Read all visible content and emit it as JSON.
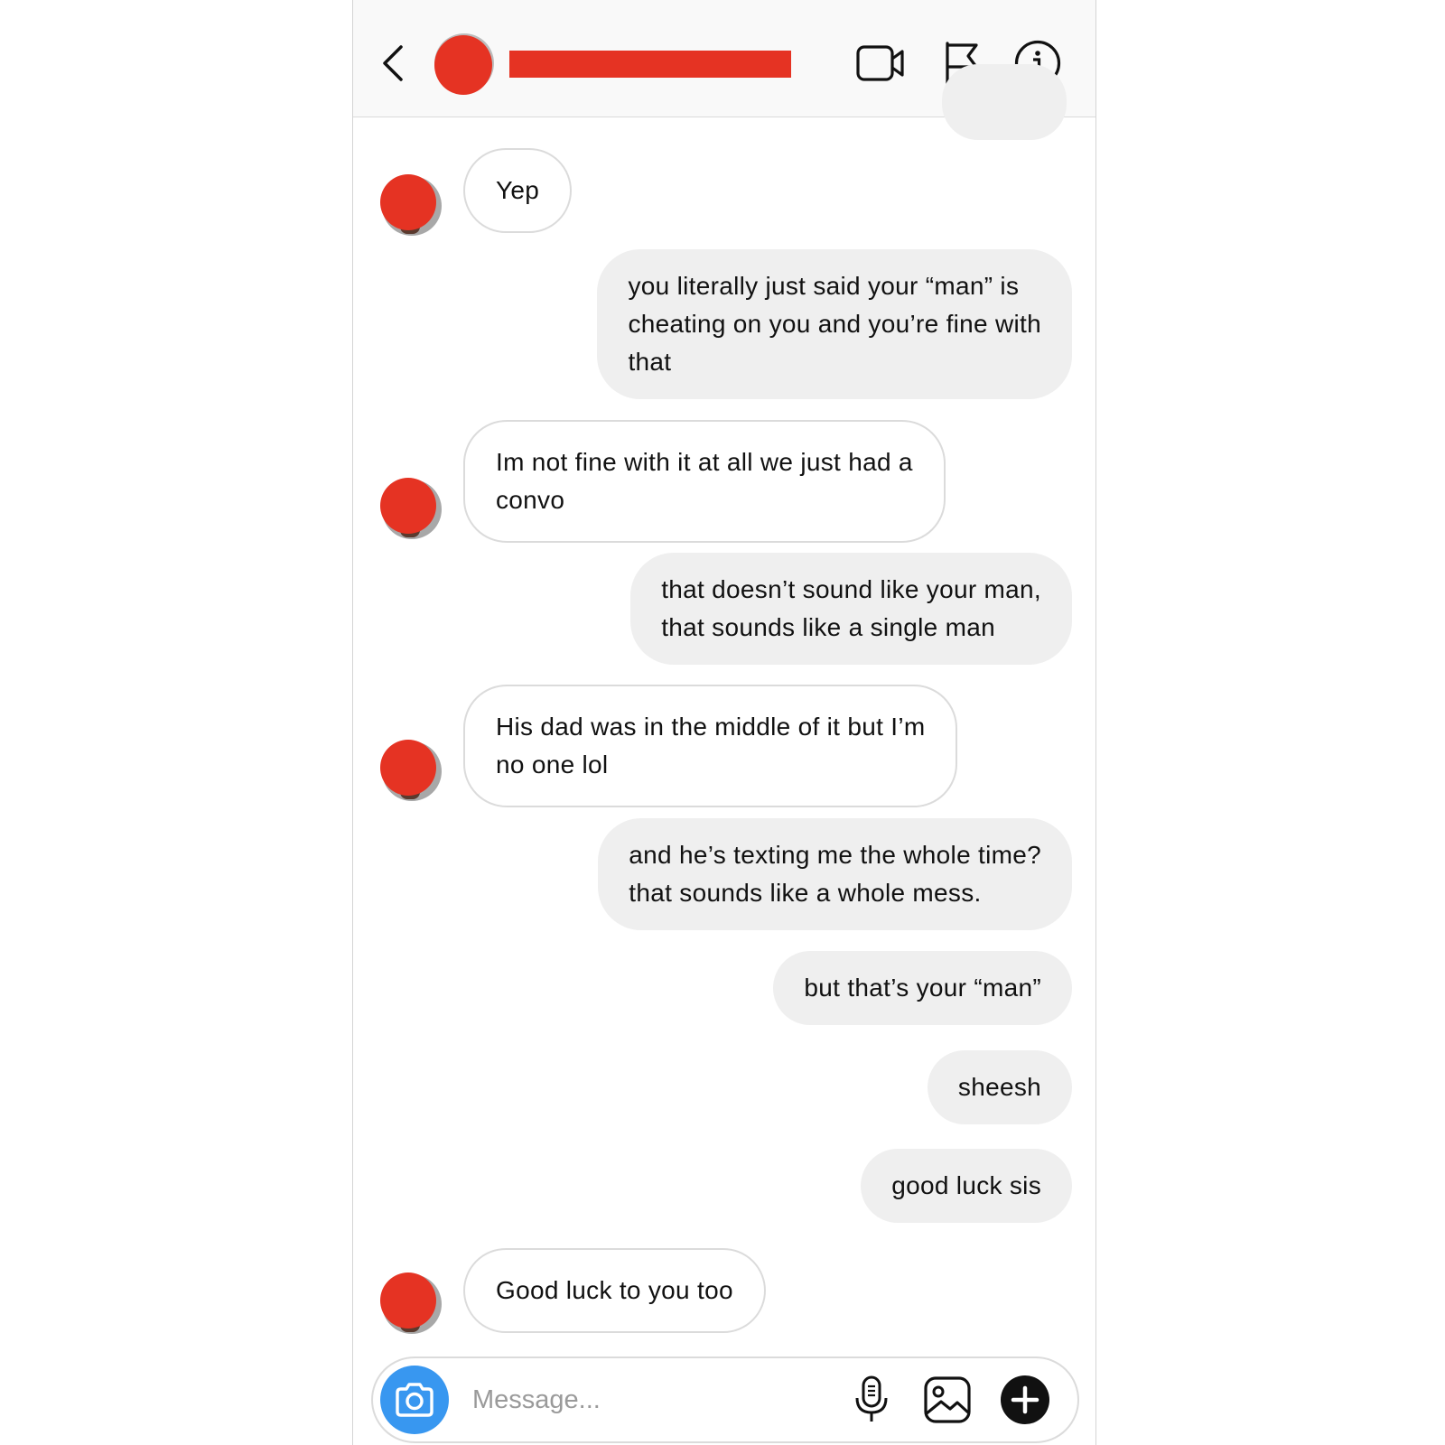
{
  "header": {
    "contact_name": "",
    "back_icon": "chevron-left-icon",
    "video_icon": "video-camera-icon",
    "flag_icon": "flag-icon",
    "info_icon": "info-icon"
  },
  "messages": [
    {
      "direction": "incoming",
      "text": "Yep"
    },
    {
      "direction": "outgoing",
      "text": "you literally just said your “man” is\ncheating on you and you’re fine with\nthat"
    },
    {
      "direction": "incoming",
      "text": "Im not fine with it at all we just had a\nconvo"
    },
    {
      "direction": "outgoing",
      "text": "that doesn’t sound like your man,\nthat sounds like a single man"
    },
    {
      "direction": "incoming",
      "text": "His dad was in the middle of it but I’m\nno one lol"
    },
    {
      "direction": "outgoing",
      "text": "and he’s texting me the whole time?\nthat sounds like a whole mess."
    },
    {
      "direction": "outgoing",
      "text": "but that’s your “man”"
    },
    {
      "direction": "outgoing",
      "text": "sheesh"
    },
    {
      "direction": "outgoing",
      "text": "good luck sis"
    },
    {
      "direction": "incoming",
      "text": "Good luck to you too"
    }
  ],
  "composer": {
    "placeholder": "Message...",
    "value": "",
    "camera_icon": "camera-icon",
    "mic_icon": "microphone-icon",
    "gallery_icon": "gallery-icon",
    "plus_icon": "plus-icon"
  },
  "colors": {
    "redaction": "#e53323",
    "camera_button": "#3897f0",
    "outgoing_bubble": "#efefef",
    "incoming_border": "#dbdbdb"
  }
}
